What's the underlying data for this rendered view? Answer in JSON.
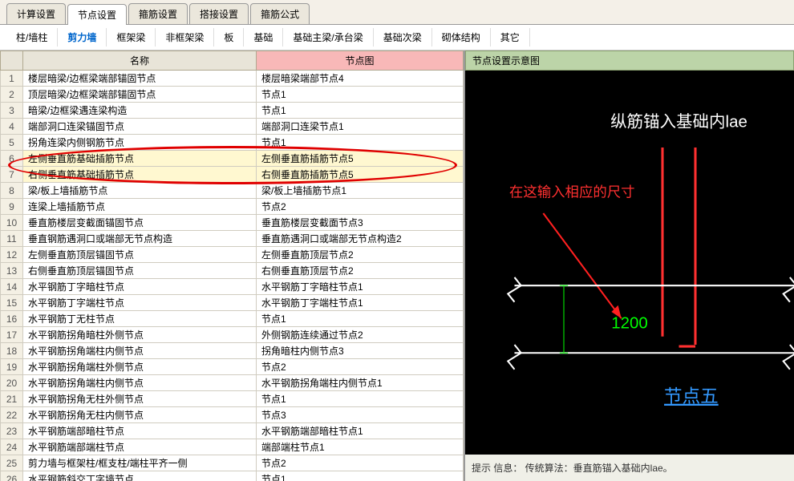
{
  "topTabs": [
    "计算设置",
    "节点设置",
    "箍筋设置",
    "搭接设置",
    "箍筋公式"
  ],
  "activeTopTab": 1,
  "subTabs": [
    "柱/墙柱",
    "剪力墙",
    "框架梁",
    "非框架梁",
    "板",
    "基础",
    "基础主梁/承台梁",
    "基础次梁",
    "砌体结构",
    "其它"
  ],
  "activeSubTab": 1,
  "cols": {
    "name": "名称",
    "diagram": "节点图"
  },
  "rows": [
    {
      "n": 1,
      "name": "楼层暗梁/边框梁端部锚固节点",
      "val": "楼层暗梁端部节点4"
    },
    {
      "n": 2,
      "name": "顶层暗梁/边框梁端部锚固节点",
      "val": "节点1"
    },
    {
      "n": 3,
      "name": "暗梁/边框梁遇连梁构造",
      "val": "节点1"
    },
    {
      "n": 4,
      "name": "端部洞口连梁锚固节点",
      "val": "端部洞口连梁节点1"
    },
    {
      "n": 5,
      "name": "拐角连梁内侧钢筋节点",
      "val": "节点1"
    },
    {
      "n": 6,
      "name": "左侧垂直筋基础插筋节点",
      "val": "左侧垂直筋插筋节点5",
      "hl": true
    },
    {
      "n": 7,
      "name": "右侧垂直筋基础插筋节点",
      "val": "右侧垂直筋插筋节点5",
      "hl": true
    },
    {
      "n": 8,
      "name": "梁/板上墙插筋节点",
      "val": "梁/板上墙插筋节点1"
    },
    {
      "n": 9,
      "name": "连梁上墙插筋节点",
      "val": "节点2"
    },
    {
      "n": 10,
      "name": "垂直筋楼层变截面锚固节点",
      "val": "垂直筋楼层变截面节点3"
    },
    {
      "n": 11,
      "name": "垂直钢筋遇洞口或端部无节点构造",
      "val": "垂直筋遇洞口或端部无节点构造2"
    },
    {
      "n": 12,
      "name": "左侧垂直筋顶层锚固节点",
      "val": "左侧垂直筋顶层节点2"
    },
    {
      "n": 13,
      "name": "右侧垂直筋顶层锚固节点",
      "val": "右侧垂直筋顶层节点2"
    },
    {
      "n": 14,
      "name": "水平钢筋丁字暗柱节点",
      "val": "水平钢筋丁字暗柱节点1"
    },
    {
      "n": 15,
      "name": "水平钢筋丁字端柱节点",
      "val": "水平钢筋丁字端柱节点1"
    },
    {
      "n": 16,
      "name": "水平钢筋丁无柱节点",
      "val": "节点1"
    },
    {
      "n": 17,
      "name": "水平钢筋拐角暗柱外侧节点",
      "val": "外侧钢筋连续通过节点2"
    },
    {
      "n": 18,
      "name": "水平钢筋拐角端柱内侧节点",
      "val": "拐角暗柱内侧节点3"
    },
    {
      "n": 19,
      "name": "水平钢筋拐角端柱外侧节点",
      "val": "节点2"
    },
    {
      "n": 20,
      "name": "水平钢筋拐角端柱内侧节点",
      "val": "水平钢筋拐角端柱内侧节点1"
    },
    {
      "n": 21,
      "name": "水平钢筋拐角无柱外侧节点",
      "val": "节点1"
    },
    {
      "n": 22,
      "name": "水平钢筋拐角无柱内侧节点",
      "val": "节点3"
    },
    {
      "n": 23,
      "name": "水平钢筋端部暗柱节点",
      "val": "水平钢筋端部暗柱节点1"
    },
    {
      "n": 24,
      "name": "水平钢筋端部端柱节点",
      "val": "端部端柱节点1"
    },
    {
      "n": 25,
      "name": "剪力墙与框架柱/框支柱/端柱平齐一侧",
      "val": "节点2"
    },
    {
      "n": 26,
      "name": "水平钢筋斜交丁字墙节点",
      "val": "节点1"
    }
  ],
  "preview": {
    "title": "节点设置示意图",
    "topLabel": "纵筋锚入基础内lae",
    "inputLabel": "在这输入相应的尺寸",
    "value": "1200",
    "caption": "节点五"
  },
  "hint": "提示 信息： 传统算法：垂直筋锚入基础内lae。"
}
